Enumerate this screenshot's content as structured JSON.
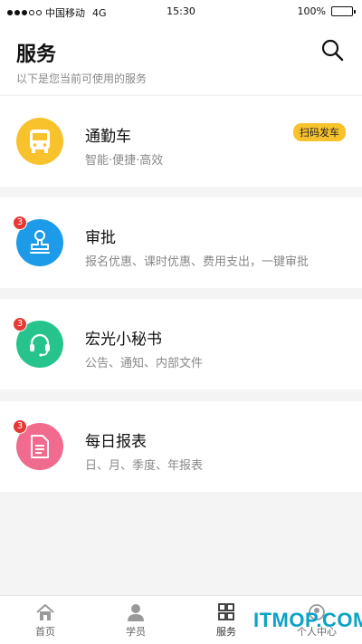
{
  "status": {
    "carrier": "中国移动",
    "network": "4G",
    "time": "15:30",
    "battery": "100%",
    "battery_level": 1.0,
    "signal_bars": 3
  },
  "header": {
    "title": "服务",
    "subtitle": "以下是您当前可使用的服务"
  },
  "services": [
    {
      "title": "通勤车",
      "desc": "智能·便捷·高效",
      "tag": "扫码发车",
      "icon": "bus-icon",
      "color": "#f7c22c"
    },
    {
      "title": "审批",
      "desc": "报名优惠、课时优惠、费用支出，一键审批",
      "badge": "3",
      "icon": "stamp-icon",
      "color": "#1e9be8"
    },
    {
      "title": "宏光小秘书",
      "desc": "公告、通知、内部文件",
      "badge": "3",
      "icon": "headset-icon",
      "color": "#26c48c"
    },
    {
      "title": "每日报表",
      "desc": "日、月、季度、年报表",
      "badge": "3",
      "icon": "document-icon",
      "color": "#f06b8e"
    }
  ],
  "tabs": [
    {
      "label": "首页",
      "icon": "home-icon"
    },
    {
      "label": "学员",
      "icon": "person-icon"
    },
    {
      "label": "服务",
      "icon": "grid-icon",
      "active": true
    },
    {
      "label": "个人中心",
      "icon": "profile-icon"
    }
  ],
  "watermark": "ITMOP.COM",
  "colors": {
    "accent_yellow": "#f7c22c",
    "badge_red": "#e53935",
    "watermark": "#0aa2c6"
  }
}
